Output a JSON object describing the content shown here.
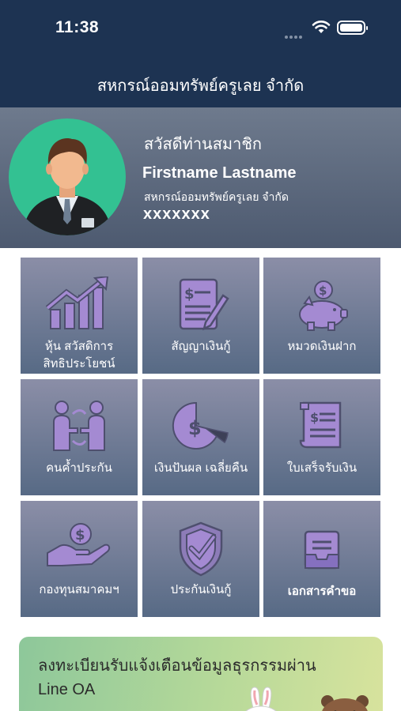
{
  "status_bar": {
    "time": "11:38"
  },
  "header": {
    "title": "สหกรณ์ออมทรัพย์ครูเลย จำกัด"
  },
  "profile": {
    "greeting": "สวัสดีท่านสมาชิก",
    "name": "Firstname Lastname",
    "cooperative": "สหกรณ์ออมทรัพย์ครูเลย จำกัด",
    "member_id": "xxxxxxx"
  },
  "menu": [
    {
      "label_line1": "หุ้น สวัสดิการ",
      "label_line2": "สิทธิประโยชน์",
      "icon": "growth-chart-icon"
    },
    {
      "label_line1": "สัญญาเงินกู้",
      "label_line2": "",
      "icon": "contract-icon"
    },
    {
      "label_line1": "หมวดเงินฝาก",
      "label_line2": "",
      "icon": "piggy-bank-icon"
    },
    {
      "label_line1": "คนค้ำประกัน",
      "label_line2": "",
      "icon": "guarantor-icon"
    },
    {
      "label_line1": "เงินปันผล เฉลี่ยคืน",
      "label_line2": "",
      "icon": "dividend-icon"
    },
    {
      "label_line1": "ใบเสร็จรับเงิน",
      "label_line2": "",
      "icon": "receipt-icon"
    },
    {
      "label_line1": "กองทุนสมาคมฯ",
      "label_line2": "",
      "icon": "fund-hand-icon"
    },
    {
      "label_line1": "ประกันเงินกู้",
      "label_line2": "",
      "icon": "shield-check-icon"
    },
    {
      "label_line1": "เอกสารคำขอ",
      "label_line2": "",
      "icon": "document-tray-icon"
    }
  ],
  "banner": {
    "line1": "ลงทะเบียนรับแจ้งเตือนข้อมูลธุรกรรมผ่าน",
    "line2": "Line OA"
  },
  "colors": {
    "navy": "#1d3352",
    "tile_top": "#8b8ea7",
    "tile_bottom": "#576a85",
    "icon_purple": "#a48ad2",
    "avatar_bg": "#33c192"
  }
}
